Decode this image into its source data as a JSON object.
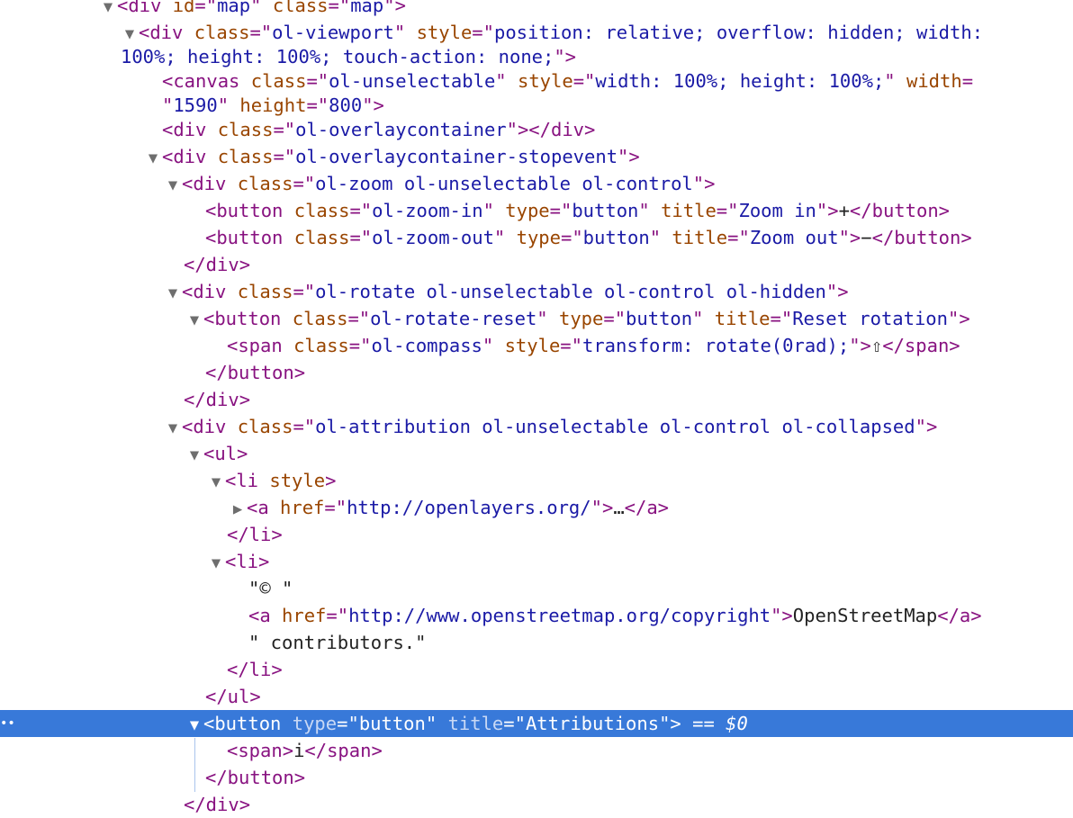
{
  "nodes": [
    {
      "indent": 110,
      "tri": "▼",
      "parts": [
        [
          "tag",
          "<div "
        ],
        [
          "attr",
          "id"
        ],
        [
          "tag",
          "=\""
        ],
        [
          "val",
          "map"
        ],
        [
          "tag",
          "\" "
        ],
        [
          "attr",
          "class"
        ],
        [
          "tag",
          "=\""
        ],
        [
          "val",
          "map"
        ],
        [
          "tag",
          "\">"
        ]
      ]
    },
    {
      "indent": 134,
      "tri": "▼",
      "parts": [
        [
          "tag",
          "<div "
        ],
        [
          "attr",
          "class"
        ],
        [
          "tag",
          "=\""
        ],
        [
          "val",
          "ol-viewport"
        ],
        [
          "tag",
          "\" "
        ],
        [
          "attr",
          "style"
        ],
        [
          "tag",
          "=\""
        ],
        [
          "val",
          "position: relative; overflow: hidden; width:"
        ]
      ]
    },
    {
      "indent": 134,
      "tri": "",
      "parts": [
        [
          "val",
          "100%; height: 100%; touch-action: none;"
        ],
        [
          "tag",
          "\">"
        ]
      ]
    },
    {
      "indent": 180,
      "tri": "",
      "parts": [
        [
          "tag",
          "<canvas "
        ],
        [
          "attr",
          "class"
        ],
        [
          "tag",
          "=\""
        ],
        [
          "val",
          "ol-unselectable"
        ],
        [
          "tag",
          "\" "
        ],
        [
          "attr",
          "style"
        ],
        [
          "tag",
          "=\""
        ],
        [
          "val",
          "width: 100%; height: 100%;"
        ],
        [
          "tag",
          "\" "
        ],
        [
          "attr",
          "width"
        ],
        [
          "tag",
          "="
        ]
      ]
    },
    {
      "indent": 180,
      "tri": "",
      "parts": [
        [
          "tag",
          "\""
        ],
        [
          "val",
          "1590"
        ],
        [
          "tag",
          "\" "
        ],
        [
          "attr",
          "height"
        ],
        [
          "tag",
          "=\""
        ],
        [
          "val",
          "800"
        ],
        [
          "tag",
          "\">"
        ]
      ]
    },
    {
      "indent": 180,
      "tri": "",
      "parts": [
        [
          "tag",
          "<div "
        ],
        [
          "attr",
          "class"
        ],
        [
          "tag",
          "=\""
        ],
        [
          "val",
          "ol-overlaycontainer"
        ],
        [
          "tag",
          "\"></div>"
        ]
      ]
    },
    {
      "indent": 160,
      "tri": "▼",
      "parts": [
        [
          "tag",
          "<div "
        ],
        [
          "attr",
          "class"
        ],
        [
          "tag",
          "=\""
        ],
        [
          "val",
          "ol-overlaycontainer-stopevent"
        ],
        [
          "tag",
          "\">"
        ]
      ]
    },
    {
      "indent": 182,
      "tri": "▼",
      "parts": [
        [
          "tag",
          "<div "
        ],
        [
          "attr",
          "class"
        ],
        [
          "tag",
          "=\""
        ],
        [
          "val",
          "ol-zoom ol-unselectable ol-control"
        ],
        [
          "tag",
          "\">"
        ]
      ]
    },
    {
      "indent": 228,
      "tri": "",
      "parts": [
        [
          "tag",
          "<button "
        ],
        [
          "attr",
          "class"
        ],
        [
          "tag",
          "=\""
        ],
        [
          "val",
          "ol-zoom-in"
        ],
        [
          "tag",
          "\" "
        ],
        [
          "attr",
          "type"
        ],
        [
          "tag",
          "=\""
        ],
        [
          "val",
          "button"
        ],
        [
          "tag",
          "\" "
        ],
        [
          "attr",
          "title"
        ],
        [
          "tag",
          "=\""
        ],
        [
          "val",
          "Zoom in"
        ],
        [
          "tag",
          "\">"
        ],
        [
          "txt",
          "+"
        ],
        [
          "tag",
          "</button>"
        ]
      ]
    },
    {
      "indent": 228,
      "tri": "",
      "parts": [
        [
          "tag",
          "<button "
        ],
        [
          "attr",
          "class"
        ],
        [
          "tag",
          "=\""
        ],
        [
          "val",
          "ol-zoom-out"
        ],
        [
          "tag",
          "\" "
        ],
        [
          "attr",
          "type"
        ],
        [
          "tag",
          "=\""
        ],
        [
          "val",
          "button"
        ],
        [
          "tag",
          "\" "
        ],
        [
          "attr",
          "title"
        ],
        [
          "tag",
          "=\""
        ],
        [
          "val",
          "Zoom out"
        ],
        [
          "tag",
          "\">"
        ],
        [
          "txt",
          "−"
        ],
        [
          "tag",
          "</button>"
        ]
      ]
    },
    {
      "indent": 204,
      "tri": "",
      "parts": [
        [
          "tag",
          "</div>"
        ]
      ]
    },
    {
      "indent": 182,
      "tri": "▼",
      "parts": [
        [
          "tag",
          "<div "
        ],
        [
          "attr",
          "class"
        ],
        [
          "tag",
          "=\""
        ],
        [
          "val",
          "ol-rotate ol-unselectable ol-control ol-hidden"
        ],
        [
          "tag",
          "\">"
        ]
      ]
    },
    {
      "indent": 206,
      "tri": "▼",
      "parts": [
        [
          "tag",
          "<button "
        ],
        [
          "attr",
          "class"
        ],
        [
          "tag",
          "=\""
        ],
        [
          "val",
          "ol-rotate-reset"
        ],
        [
          "tag",
          "\" "
        ],
        [
          "attr",
          "type"
        ],
        [
          "tag",
          "=\""
        ],
        [
          "val",
          "button"
        ],
        [
          "tag",
          "\" "
        ],
        [
          "attr",
          "title"
        ],
        [
          "tag",
          "=\""
        ],
        [
          "val",
          "Reset rotation"
        ],
        [
          "tag",
          "\">"
        ]
      ]
    },
    {
      "indent": 252,
      "tri": "",
      "parts": [
        [
          "tag",
          "<span "
        ],
        [
          "attr",
          "class"
        ],
        [
          "tag",
          "=\""
        ],
        [
          "val",
          "ol-compass"
        ],
        [
          "tag",
          "\" "
        ],
        [
          "attr",
          "style"
        ],
        [
          "tag",
          "=\""
        ],
        [
          "val",
          "transform: rotate(0rad);"
        ],
        [
          "tag",
          "\">"
        ],
        [
          "txt",
          "⇧"
        ],
        [
          "tag",
          "</span>"
        ]
      ]
    },
    {
      "indent": 228,
      "tri": "",
      "parts": [
        [
          "tag",
          "</button>"
        ]
      ]
    },
    {
      "indent": 204,
      "tri": "",
      "parts": [
        [
          "tag",
          "</div>"
        ]
      ]
    },
    {
      "indent": 182,
      "tri": "▼",
      "parts": [
        [
          "tag",
          "<div "
        ],
        [
          "attr",
          "class"
        ],
        [
          "tag",
          "=\""
        ],
        [
          "val",
          "ol-attribution ol-unselectable ol-control ol-collapsed"
        ],
        [
          "tag",
          "\">"
        ]
      ]
    },
    {
      "indent": 206,
      "tri": "▼",
      "parts": [
        [
          "tag",
          "<ul>"
        ]
      ]
    },
    {
      "indent": 230,
      "tri": "▼",
      "parts": [
        [
          "tag",
          "<li "
        ],
        [
          "attr",
          "style"
        ],
        [
          "tag",
          ">"
        ]
      ]
    },
    {
      "indent": 254,
      "tri": "▶",
      "parts": [
        [
          "tag",
          "<a "
        ],
        [
          "attr",
          "href"
        ],
        [
          "tag",
          "=\""
        ],
        [
          "url",
          "http://openlayers.org/"
        ],
        [
          "tag",
          "\">"
        ],
        [
          "txt",
          "…"
        ],
        [
          "tag",
          "</a>"
        ]
      ]
    },
    {
      "indent": 252,
      "tri": "",
      "parts": [
        [
          "tag",
          "</li>"
        ]
      ]
    },
    {
      "indent": 230,
      "tri": "▼",
      "parts": [
        [
          "tag",
          "<li>"
        ]
      ]
    },
    {
      "indent": 276,
      "tri": "",
      "parts": [
        [
          "txt",
          "\"© \""
        ]
      ]
    },
    {
      "indent": 276,
      "tri": "",
      "parts": [
        [
          "tag",
          "<a "
        ],
        [
          "attr",
          "href"
        ],
        [
          "tag",
          "=\""
        ],
        [
          "url",
          "http://www.openstreetmap.org/copyright"
        ],
        [
          "tag",
          "\">"
        ],
        [
          "txt",
          "OpenStreetMap"
        ],
        [
          "tag",
          "</a>"
        ]
      ]
    },
    {
      "indent": 276,
      "tri": "",
      "parts": [
        [
          "txt",
          "\" contributors.\""
        ]
      ]
    },
    {
      "indent": 252,
      "tri": "",
      "parts": [
        [
          "tag",
          "</li>"
        ]
      ]
    },
    {
      "indent": 228,
      "tri": "",
      "parts": [
        [
          "tag",
          "</ul>"
        ]
      ]
    },
    {
      "indent": 206,
      "tri": "▼",
      "selected": true,
      "parts": [
        [
          "tag",
          "<button "
        ],
        [
          "attr",
          "type"
        ],
        [
          "tag",
          "=\""
        ],
        [
          "val",
          "button"
        ],
        [
          "tag",
          "\" "
        ],
        [
          "attr",
          "title"
        ],
        [
          "tag",
          "=\""
        ],
        [
          "val",
          "Attributions"
        ],
        [
          "tag",
          "\">"
        ],
        [
          "sel-extra",
          " == $0"
        ]
      ]
    },
    {
      "indent": 252,
      "tri": "",
      "parts": [
        [
          "tag",
          "<span>"
        ],
        [
          "txt",
          "i"
        ],
        [
          "tag",
          "</span>"
        ]
      ]
    },
    {
      "indent": 228,
      "tri": "",
      "parts": [
        [
          "tag",
          "</button>"
        ]
      ]
    },
    {
      "indent": 204,
      "tri": "",
      "parts": [
        [
          "tag",
          "</div>"
        ]
      ]
    }
  ],
  "selection_marker": "••"
}
